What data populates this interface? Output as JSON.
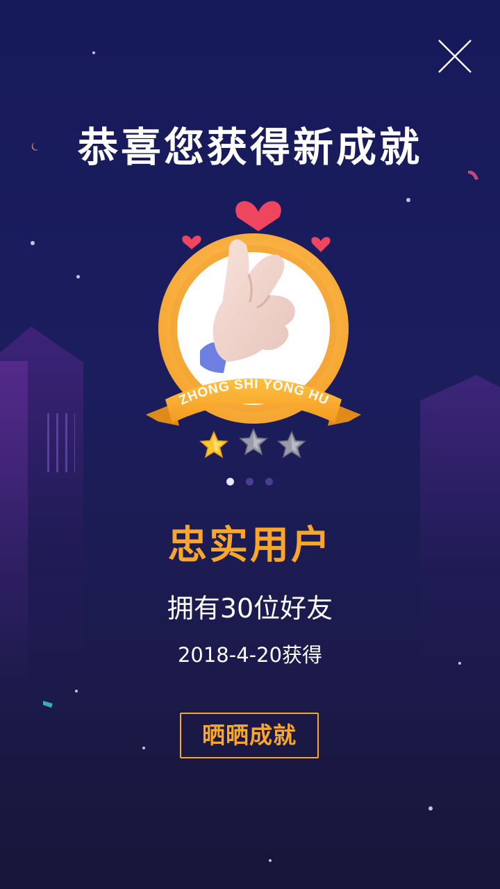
{
  "header": {
    "close_icon": "close-icon"
  },
  "dialog": {
    "title": "恭喜您获得新成就",
    "badge": {
      "ribbon_text": "ZHONG SHI YONG HU",
      "icon": "finger-heart-icon",
      "stars_filled": 1,
      "stars_total": 3
    },
    "pager": {
      "count": 3,
      "active_index": 0
    },
    "achievement_name": "忠实用户",
    "achievement_desc": "拥有30位好友",
    "achievement_date": "2018-4-20获得",
    "share_button": "晒晒成就"
  },
  "colors": {
    "accent": "#f9a62b",
    "background_top": "#16195a",
    "background_bottom": "#181638",
    "star_gold": "#ffc830",
    "star_gray": "#9a9aa8"
  }
}
